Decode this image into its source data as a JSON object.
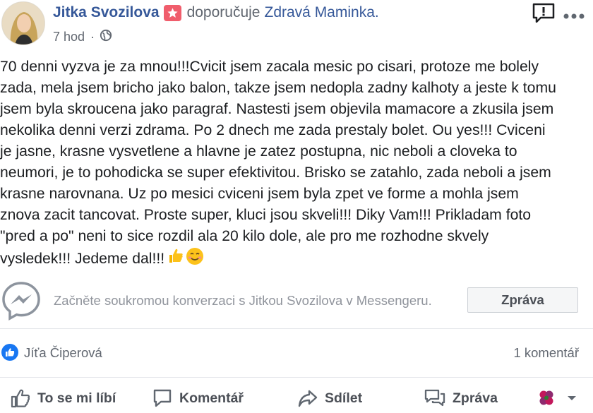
{
  "header": {
    "author": "Jitka Svozilova",
    "recommends_text": "doporučuje",
    "page_name": "Zdravá Maminka.",
    "time": "7 hod",
    "dot": "·"
  },
  "post": {
    "text": "70 denni vyzva je za mnou!!!Cvicit jsem zacala mesic po cisari, protoze me bolely\nzada, mela jsem bricho jako balon, takze jsem nedopla zadny kalhoty a jeste k tomu\njsem byla skroucena jako paragraf. Nastesti jsem objevila mamacore a zkusila jsem\nnekolika denni verzi zdrama. Po 2 dnech me zada prestaly bolet. Ou yes!!! Cviceni\nje jasne, krasne vysvetlene a hlavne je zatez postupna, nic neboli a cloveka to\nneumori, je to pohodicka se super efektivitou. Brisko se zatahlo, zada neboli a jsem\nkrasne narovnana. Uz po mesici cviceni jsem byla zpet ve forme a mohla jsem\nznova zacit tancovat. Proste super, kluci jsou skveli!!! Diky Vam!!! Prikladam foto\n\"pred a po\" neni to sice rozdil ala 20 kilo dole, ale pro me rozhodne skvely\nvysledek!!! Jedeme dal!!!",
    "emojis": [
      "thumbs-up",
      "smiling-face"
    ]
  },
  "messenger": {
    "prompt": "Začněte soukromou konverzaci s Jitkou Svozilova v Messengeru.",
    "button_label": "Zpráva"
  },
  "reactions": {
    "liker_name": "Jíťa Čiperová",
    "comments_count": "1 komentář"
  },
  "actions": {
    "like": "To se mi líbí",
    "comment": "Komentář",
    "share": "Sdílet",
    "message": "Zpráva"
  },
  "colors": {
    "link_blue": "#365899",
    "like_blue": "#1877f2",
    "badge_red": "#f05d6c",
    "secondary_text": "#616770"
  }
}
